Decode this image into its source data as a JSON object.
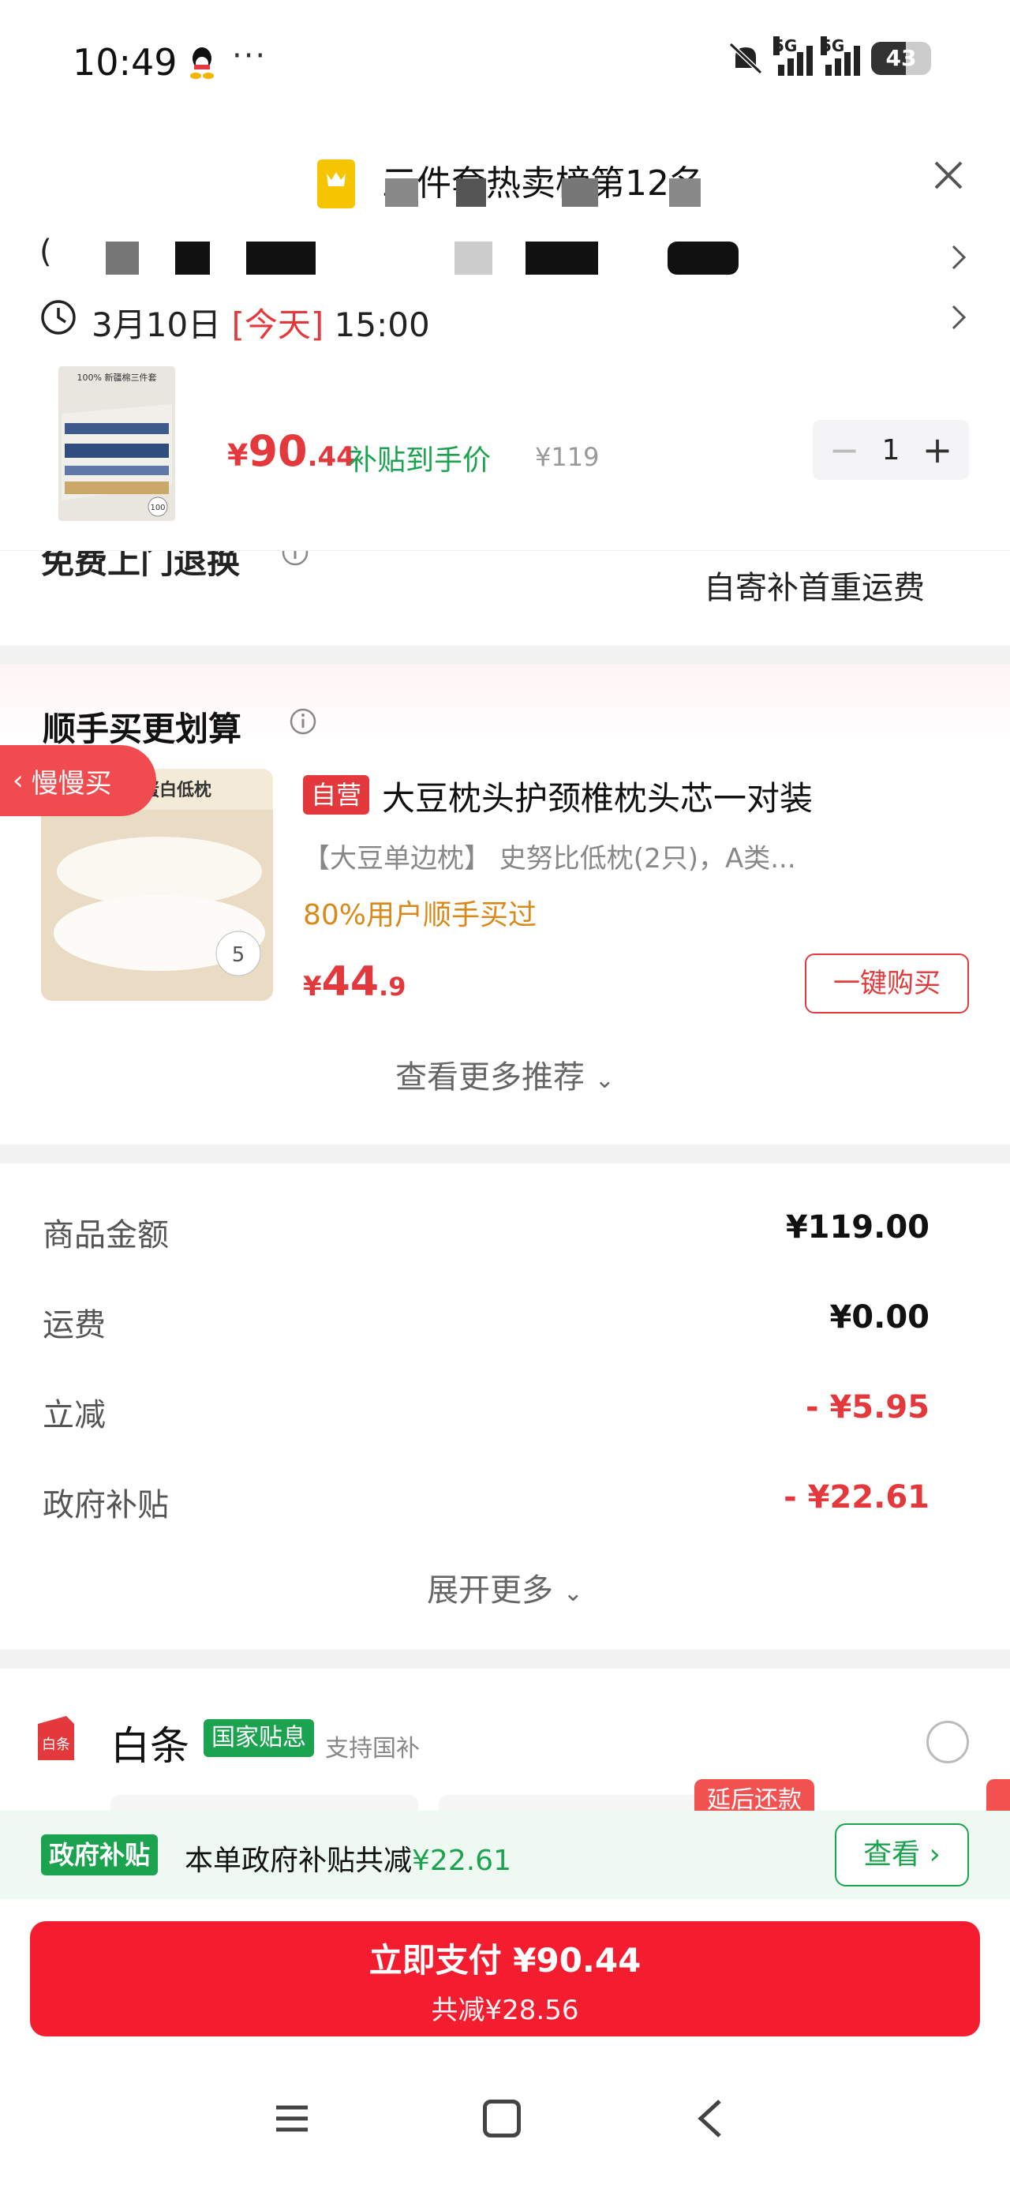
{
  "status_bar": {
    "time": "10:49",
    "more": "···",
    "network_1": "5G",
    "network_2": "5G",
    "battery": "43"
  },
  "header": {
    "rank_title": "三件套热卖榜第12名",
    "address_prefix": "(",
    "delivery_date": "3月10日",
    "delivery_today": "[今天]",
    "delivery_time": "15:00"
  },
  "product": {
    "thumb_caption": "100% 新疆棉三件套",
    "price_symbol": "¥",
    "price_int": "90",
    "price_dec": ".44",
    "subsidy_label": "补贴到手价",
    "original_price": "¥119",
    "quantity": "1",
    "minus": "−",
    "plus": "+"
  },
  "return_service": {
    "label": "免费上门退换",
    "value": "自寄补首重运费"
  },
  "recommend": {
    "title": "顺手买更划算",
    "slow_buy": "慢慢买",
    "image_caption": "大豆蛋白低枕",
    "self_tag": "自营",
    "name": "大豆枕头护颈椎枕头芯一对装",
    "desc": "【大豆单边枕】 史努比低枕(2只)，A类...",
    "bought": "80%用户顺手买过",
    "price_symbol": "¥",
    "price_int": "44",
    "price_dec": ".9",
    "buy_button": "一键购买",
    "more": "查看更多推荐"
  },
  "summary": {
    "rows": [
      {
        "label": "商品金额",
        "value": "¥119.00"
      },
      {
        "label": "运费",
        "value": "¥0.00"
      },
      {
        "label": "立减",
        "value": "- ¥5.95"
      },
      {
        "label": "政府补贴",
        "value": "- ¥22.61"
      }
    ],
    "expand": "展开更多"
  },
  "payment": {
    "icon_text": "白条",
    "name": "白条",
    "gov_tag": "国家贴息",
    "support": "支持国补",
    "later_tag": "延后还款"
  },
  "gov_bar": {
    "tag": "政府补贴",
    "text": "本单政府补贴共减",
    "amount": "¥22.61",
    "view": "查看 ›"
  },
  "pay_button": {
    "main": "立即支付 ¥90.44",
    "sub": "共减¥28.56"
  },
  "colors": {
    "accent_red": "#e4393c",
    "subsidy_green": "#1ca34f",
    "pay_red": "#f31d2f"
  }
}
